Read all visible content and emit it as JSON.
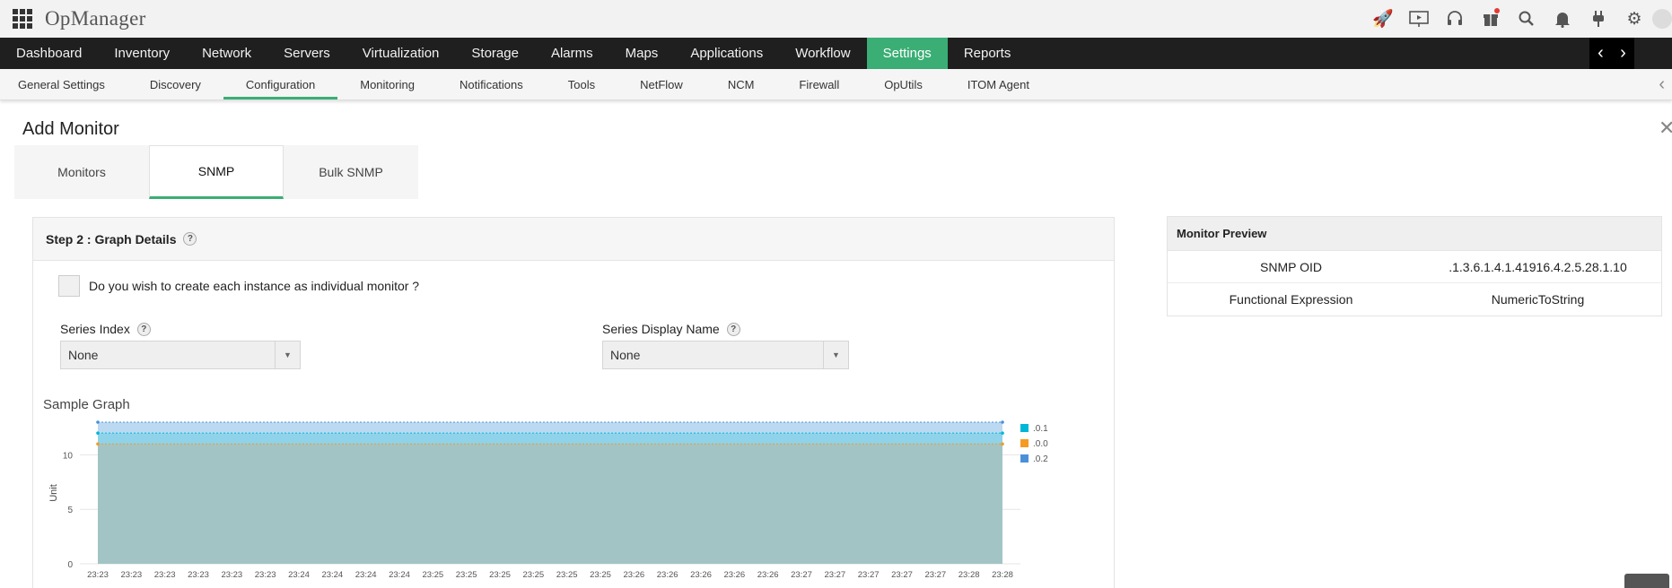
{
  "app": {
    "brand": "OpManager"
  },
  "top_icons": [
    "rocket-icon",
    "presentation-icon",
    "headset-icon",
    "gift-icon",
    "search-icon",
    "bell-icon",
    "plug-icon",
    "gear-icon"
  ],
  "main_nav": [
    "Dashboard",
    "Inventory",
    "Network",
    "Servers",
    "Virtualization",
    "Storage",
    "Alarms",
    "Maps",
    "Applications",
    "Workflow",
    "Settings",
    "Reports"
  ],
  "main_nav_active": "Settings",
  "sub_nav": [
    "General Settings",
    "Discovery",
    "Configuration",
    "Monitoring",
    "Notifications",
    "Tools",
    "NetFlow",
    "NCM",
    "Firewall",
    "OpUtils",
    "ITOM Agent"
  ],
  "sub_nav_active": "Configuration",
  "page": {
    "title": "Add Monitor",
    "tabs": [
      "Monitors",
      "SNMP",
      "Bulk SNMP"
    ],
    "active_tab": "SNMP"
  },
  "step": {
    "title": "Step 2 : Graph Details",
    "help": "?",
    "checkbox_label": "Do you wish to create each instance as individual monitor ?",
    "series_index_label": "Series Index",
    "series_index_value": "None",
    "series_display_label": "Series Display Name",
    "series_display_value": "None",
    "graph_title": "Sample Graph"
  },
  "preview": {
    "title": "Monitor Preview",
    "rows": [
      {
        "key": "SNMP OID",
        "value": ".1.3.6.1.4.1.41916.4.2.5.28.1.10"
      },
      {
        "key": "Functional Expression",
        "value": "NumericToString"
      }
    ]
  },
  "colors": {
    "accent": "#3aae74",
    "nav_bg": "#1f1f1f",
    "series_0_1": "#00b6d8",
    "series_0_0": "#f59a23",
    "series_0_2": "#4a90d9"
  },
  "chart_data": {
    "type": "area",
    "ylabel": "Unit",
    "ylim": [
      0,
      13
    ],
    "yticks": [
      0,
      5,
      10
    ],
    "x": [
      "23:23",
      "23:23",
      "23:23",
      "23:23",
      "23:23",
      "23:23",
      "23:24",
      "23:24",
      "23:24",
      "23:24",
      "23:25",
      "23:25",
      "23:25",
      "23:25",
      "23:25",
      "23:25",
      "23:26",
      "23:26",
      "23:26",
      "23:26",
      "23:26",
      "23:27",
      "23:27",
      "23:27",
      "23:27",
      "23:27",
      "23:28",
      "23:28"
    ],
    "grid": true,
    "legend_position": "right",
    "series": [
      {
        "name": ".0.1",
        "values": [
          12,
          12,
          12,
          12,
          12,
          12,
          12,
          12,
          12,
          12,
          12,
          12,
          12,
          12,
          12,
          12,
          12,
          12,
          12,
          12,
          12,
          12,
          12,
          12,
          12,
          12,
          12,
          12
        ]
      },
      {
        "name": ".0.0",
        "values": [
          11,
          11,
          11,
          11,
          11,
          11,
          11,
          11,
          11,
          11,
          11,
          11,
          11,
          11,
          11,
          11,
          11,
          11,
          11,
          11,
          11,
          11,
          11,
          11,
          11,
          11,
          11,
          11
        ]
      },
      {
        "name": ".0.2",
        "values": [
          13,
          13,
          13,
          13,
          13,
          13,
          13,
          13,
          13,
          13,
          13,
          13,
          13,
          13,
          13,
          13,
          13,
          13,
          13,
          13,
          13,
          13,
          13,
          13,
          13,
          13,
          13,
          13
        ]
      }
    ]
  }
}
